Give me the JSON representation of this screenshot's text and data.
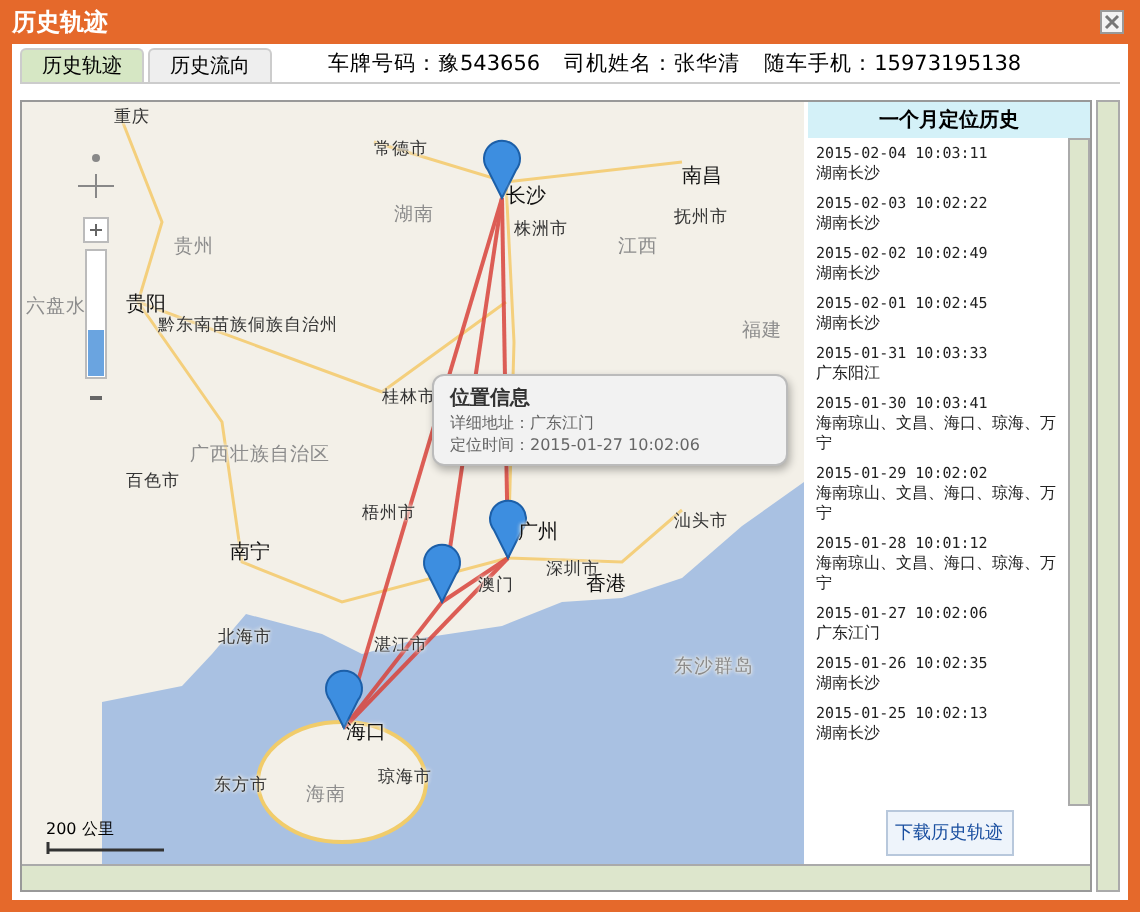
{
  "window": {
    "title": "历史轨迹"
  },
  "tabs": [
    {
      "label": "历史轨迹",
      "selected": true
    },
    {
      "label": "历史流向",
      "selected": false
    }
  ],
  "vehicle_info": [
    "车牌号码：豫543656",
    "司机姓名：张华清",
    "随车手机：15973195138"
  ],
  "map": {
    "cities": [
      {
        "name": "重庆"
      },
      {
        "name": "常德市"
      },
      {
        "name": "长沙"
      },
      {
        "name": "南昌"
      },
      {
        "name": "湖南"
      },
      {
        "name": "贵州"
      },
      {
        "name": "江西"
      },
      {
        "name": "抚州市"
      },
      {
        "name": "株洲市"
      },
      {
        "name": "贵阳"
      },
      {
        "name": "六盘水"
      },
      {
        "name": "黔东南苗族侗族自治州"
      },
      {
        "name": "福建"
      },
      {
        "name": "桂林市"
      },
      {
        "name": "广西壮族自治区"
      },
      {
        "name": "百色市"
      },
      {
        "name": "梧州市"
      },
      {
        "name": "南宁"
      },
      {
        "name": "广州"
      },
      {
        "name": "汕头市"
      },
      {
        "name": "澳门"
      },
      {
        "name": "深圳市"
      },
      {
        "name": "香港"
      },
      {
        "name": "北海市"
      },
      {
        "name": "湛江市"
      },
      {
        "name": "东沙群岛"
      },
      {
        "name": "海口"
      },
      {
        "name": "东方市"
      },
      {
        "name": "海南"
      },
      {
        "name": "琼海市"
      }
    ],
    "popup": {
      "title": "位置信息",
      "address": "详细地址：广东江门",
      "time": "定位时间：2015-01-27 10:02:06"
    },
    "scale": "200 公里"
  },
  "history": {
    "title": "一个月定位历史",
    "entries": [
      {
        "time": "2015-02-04 10:03:11",
        "place": "湖南长沙"
      },
      {
        "time": "2015-02-03 10:02:22",
        "place": "湖南长沙"
      },
      {
        "time": "2015-02-02 10:02:49",
        "place": "湖南长沙"
      },
      {
        "time": "2015-02-01 10:02:45",
        "place": "湖南长沙"
      },
      {
        "time": "2015-01-31 10:03:33",
        "place": "广东阳江"
      },
      {
        "time": "2015-01-30 10:03:41",
        "place": "海南琼山、文昌、海口、琼海、万宁"
      },
      {
        "time": "2015-01-29 10:02:02",
        "place": "海南琼山、文昌、海口、琼海、万宁"
      },
      {
        "time": "2015-01-28 10:01:12",
        "place": "海南琼山、文昌、海口、琼海、万宁"
      },
      {
        "time": "2015-01-27 10:02:06",
        "place": "广东江门"
      },
      {
        "time": "2015-01-26 10:02:35",
        "place": "湖南长沙"
      },
      {
        "time": "2015-01-25 10:02:13",
        "place": "湖南长沙"
      }
    ],
    "download_button": "下载历史轨迹"
  }
}
